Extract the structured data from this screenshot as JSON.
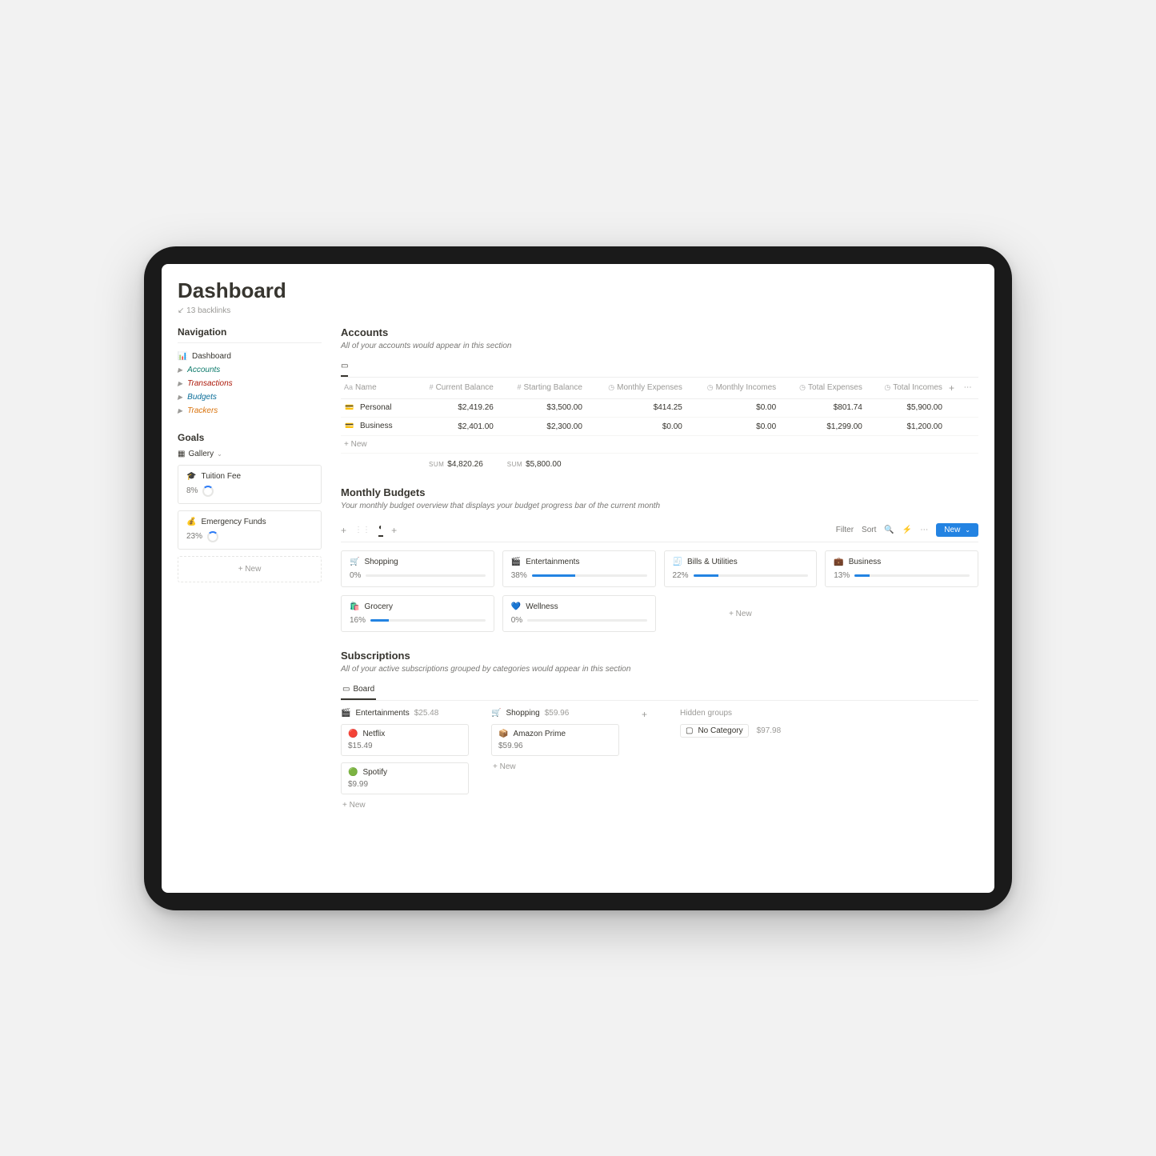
{
  "page": {
    "title": "Dashboard",
    "backlinks": "13 backlinks"
  },
  "navigation": {
    "heading": "Navigation",
    "items": [
      {
        "label": "Dashboard",
        "icon": "📘"
      },
      {
        "label": "Accounts"
      },
      {
        "label": "Transactions"
      },
      {
        "label": "Budgets"
      },
      {
        "label": "Trackers"
      }
    ]
  },
  "goals": {
    "heading": "Goals",
    "view_label": "Gallery",
    "cards": [
      {
        "icon": "🎓",
        "title": "Tuition Fee",
        "progress": "8%"
      },
      {
        "icon": "💰",
        "title": "Emergency Funds",
        "progress": "23%"
      }
    ],
    "new_label": "+ New"
  },
  "accounts": {
    "heading": "Accounts",
    "desc": "All of your accounts would appear in this section",
    "columns": [
      "Name",
      "Current Balance",
      "Starting Balance",
      "Monthly Expenses",
      "Monthly Incomes",
      "Total Expenses",
      "Total Incomes"
    ],
    "rows": [
      {
        "name": "Personal",
        "current": "$2,419.26",
        "starting": "$3,500.00",
        "mexp": "$414.25",
        "minc": "$0.00",
        "texp": "$801.74",
        "tinc": "$5,900.00"
      },
      {
        "name": "Business",
        "current": "$2,401.00",
        "starting": "$2,300.00",
        "mexp": "$0.00",
        "minc": "$0.00",
        "texp": "$1,299.00",
        "tinc": "$1,200.00"
      }
    ],
    "new_label": "+ New",
    "sum_label": "SUM",
    "sum_current": "$4,820.26",
    "sum_starting": "$5,800.00"
  },
  "budgets": {
    "heading": "Monthly Budgets",
    "desc": "Your monthly budget overview that displays your budget progress bar of the current month",
    "toolbar": {
      "filter": "Filter",
      "sort": "Sort",
      "new": "New"
    },
    "cards": [
      {
        "icon": "🛒",
        "title": "Shopping",
        "pct": "0%",
        "w": 0
      },
      {
        "icon": "🎬",
        "title": "Entertainments",
        "pct": "38%",
        "w": 38
      },
      {
        "icon": "🧾",
        "title": "Bills & Utilities",
        "pct": "22%",
        "w": 22
      },
      {
        "icon": "💼",
        "title": "Business",
        "pct": "13%",
        "w": 13
      },
      {
        "icon": "🛍️",
        "title": "Grocery",
        "pct": "16%",
        "w": 16
      },
      {
        "icon": "💙",
        "title": "Wellness",
        "pct": "0%",
        "w": 0
      }
    ],
    "new_label": "+ New"
  },
  "subscriptions": {
    "heading": "Subscriptions",
    "desc": "All of your active subscriptions grouped by categories would appear in this section",
    "tab": "Board",
    "columns": [
      {
        "icon": "🎬",
        "title": "Entertainments",
        "amount": "$25.48",
        "cards": [
          {
            "icon": "🔴",
            "title": "Netflix",
            "price": "$15.49"
          },
          {
            "icon": "🟢",
            "title": "Spotify",
            "price": "$9.99"
          }
        ]
      },
      {
        "icon": "🛒",
        "title": "Shopping",
        "amount": "$59.96",
        "cards": [
          {
            "icon": "📦",
            "title": "Amazon Prime",
            "price": "$59.96"
          }
        ]
      }
    ],
    "hidden_label": "Hidden groups",
    "nocat": {
      "label": "No Category",
      "amount": "$97.98"
    },
    "new_label": "+ New"
  }
}
